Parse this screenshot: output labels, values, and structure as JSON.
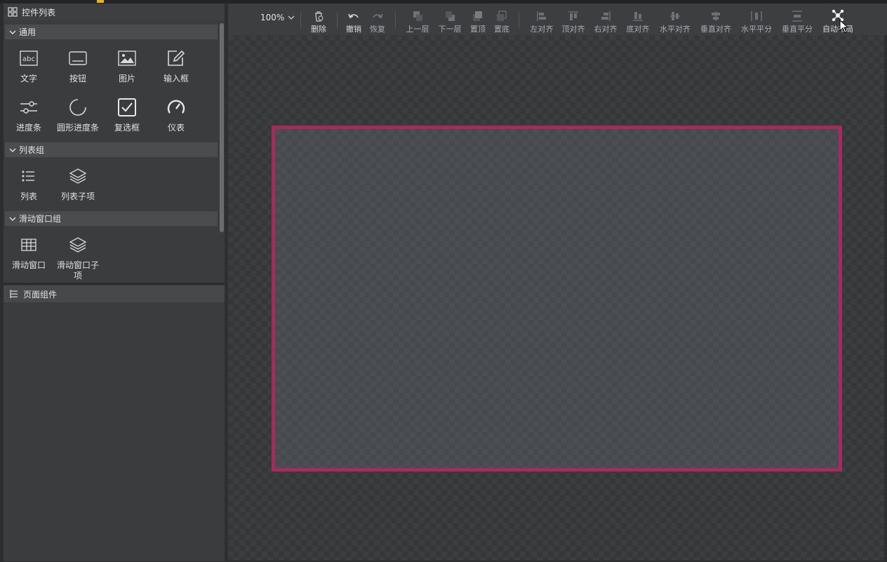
{
  "left_panel": {
    "title": "控件列表",
    "groups": {
      "general": {
        "label": "通用",
        "items": [
          "文字",
          "按钮",
          "图片",
          "输入框",
          "进度条",
          "圆形进度条",
          "复选框",
          "仪表"
        ]
      },
      "list_group": {
        "label": "列表组",
        "items": [
          "列表",
          "列表子项"
        ]
      },
      "scroll_group": {
        "label": "滑动窗口组",
        "items": [
          "滑动窗口",
          "滑动窗口子项"
        ]
      }
    },
    "components_title": "页面组件"
  },
  "toolbar": {
    "zoom": "100%",
    "buttons": {
      "delete": "删除",
      "undo": "撤销",
      "redo": "恢复",
      "move_up": "上一层",
      "move_down": "下一层",
      "to_top": "置顶",
      "to_bottom": "置底",
      "align_left": "左对齐",
      "align_top": "顶对齐",
      "align_right": "右对齐",
      "align_bottom": "底对齐",
      "align_h_center": "水平对齐",
      "align_v_center": "垂直对齐",
      "distribute_h": "水平平分",
      "distribute_v": "垂直平分",
      "auto_layout": "自动布局"
    }
  },
  "colors": {
    "page_border": "#a62b5c",
    "panel_bg": "#3a3c3e",
    "toolbar_bg": "#3c3e40"
  }
}
